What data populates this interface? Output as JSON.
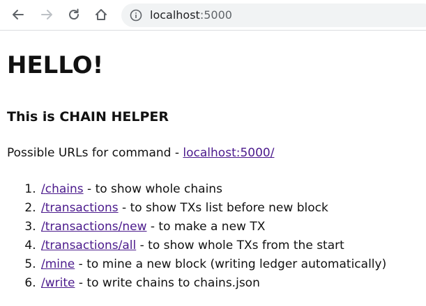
{
  "browser": {
    "url_host": "localhost",
    "url_port": ":5000",
    "icons": [
      "back-icon",
      "forward-icon",
      "reload-icon",
      "home-icon",
      "info-icon"
    ]
  },
  "page": {
    "heading": "HELLO!",
    "subheading": "This is CHAIN HELPER",
    "intro_text": "Possible URLs for command - ",
    "intro_link": "localhost:5000/",
    "routes": [
      {
        "path": "/chains",
        "description": " - to show whole chains"
      },
      {
        "path": "/transactions",
        "description": " - to show TXs list before new block"
      },
      {
        "path": "/transactions/new",
        "description": " - to make a new TX"
      },
      {
        "path": "/transactions/all",
        "description": " - to show whole TXs from the start"
      },
      {
        "path": "/mine",
        "description": " - to mine a new block (writing ledger automatically)"
      },
      {
        "path": "/write",
        "description": " - to write chains to chains.json"
      }
    ]
  },
  "colors": {
    "link": "#4b1a8c",
    "text": "#111111",
    "toolbar_border": "#dadce0",
    "omnibox_bg": "#f1f3f4"
  }
}
